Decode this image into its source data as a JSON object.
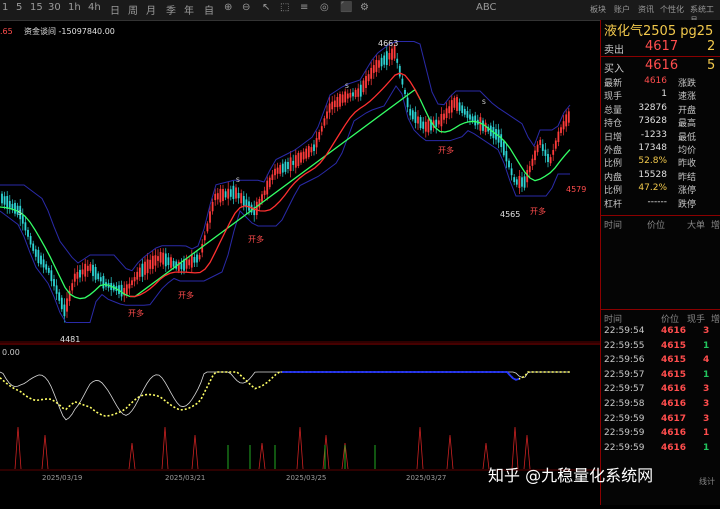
{
  "toolbar": {
    "items": [
      "1",
      "5",
      "15",
      "30",
      "1h",
      "4h",
      "日",
      "周",
      "月",
      "季",
      "年",
      "自",
      "⊕",
      "⊖",
      "↖",
      "⬚",
      "≡",
      "◎",
      "⬛",
      "⚙",
      "ABC"
    ],
    "right_items": [
      "板块",
      "账户",
      "资讯",
      "个性化",
      "系统工具"
    ]
  },
  "chart": {
    "top_label": "资金谈间 -15097840.00",
    "left_partial": ".65",
    "sub_label": "0.00",
    "high_label": "4663",
    "low_label": "4481",
    "label_4565": "4565",
    "label_4579": "4579",
    "open_label": "开多",
    "signal_s": "S",
    "dates": [
      "2025/03/19",
      "2025/03/21",
      "2025/03/25",
      "2025/03/27"
    ],
    "colors": {
      "up": "#ff3b3b",
      "down": "#2dd4d4",
      "ma_green": "#33ff66",
      "ma_red": "#ff3030",
      "band": "#2a2aa8",
      "osc_white": "#d8d8d8",
      "osc_yellow": "#ffff66",
      "osc_blue": "#2233ff"
    }
  },
  "panel": {
    "contract": "液化气2505  pg25",
    "sell_label": "卖出",
    "sell_price": "4617",
    "sell_vol": "2",
    "buy_label": "买入",
    "buy_price": "4616",
    "buy_vol": "5",
    "quote_rows": [
      {
        "l1": "最新",
        "v1": "4616",
        "c": "red",
        "l2": "涨跌"
      },
      {
        "l1": "现手",
        "v1": "1",
        "c": "white",
        "l2": "速涨"
      },
      {
        "l1": "总量",
        "v1": "32876",
        "c": "white",
        "l2": "开盘"
      },
      {
        "l1": "持仓",
        "v1": "73628",
        "c": "white",
        "l2": "最高"
      },
      {
        "l1": "日增",
        "v1": "-1233",
        "c": "white",
        "l2": "最低"
      },
      {
        "l1": "外盘",
        "v1": "17348",
        "c": "white",
        "l2": "均价"
      },
      {
        "l1": "比例",
        "v1": "52.8%",
        "c": "yellow",
        "l2": "昨收"
      },
      {
        "l1": "内盘",
        "v1": "15528",
        "c": "white",
        "l2": "昨结"
      },
      {
        "l1": "比例",
        "v1": "47.2%",
        "c": "yellow",
        "l2": "涨停"
      },
      {
        "l1": "杠杆",
        "v1": "------",
        "c": "white",
        "l2": "跌停"
      }
    ],
    "sec1": {
      "c1": "时间",
      "c2": "价位",
      "c3": "大单",
      "c4": "增"
    },
    "sec2": {
      "c1": "时间",
      "c2": "价位",
      "c3": "现手",
      "c4": "增"
    },
    "ticks": [
      {
        "time": "22:59:54",
        "price": "4616",
        "vol": "3",
        "c": "red"
      },
      {
        "time": "22:59:55",
        "price": "4615",
        "vol": "1",
        "c": "green"
      },
      {
        "time": "22:59:56",
        "price": "4615",
        "vol": "4",
        "c": "red"
      },
      {
        "time": "22:59:57",
        "price": "4615",
        "vol": "1",
        "c": "green"
      },
      {
        "time": "22:59:57",
        "price": "4616",
        "vol": "3",
        "c": "red"
      },
      {
        "time": "22:59:58",
        "price": "4616",
        "vol": "3",
        "c": "red"
      },
      {
        "time": "22:59:59",
        "price": "4617",
        "vol": "3",
        "c": "red"
      },
      {
        "time": "22:59:59",
        "price": "4616",
        "vol": "1",
        "c": "red"
      },
      {
        "time": "22:59:59",
        "price": "4616",
        "vol": "1",
        "c": "green"
      }
    ],
    "footer": "线计"
  },
  "watermark": "知乎 @九稳量化系统网"
}
